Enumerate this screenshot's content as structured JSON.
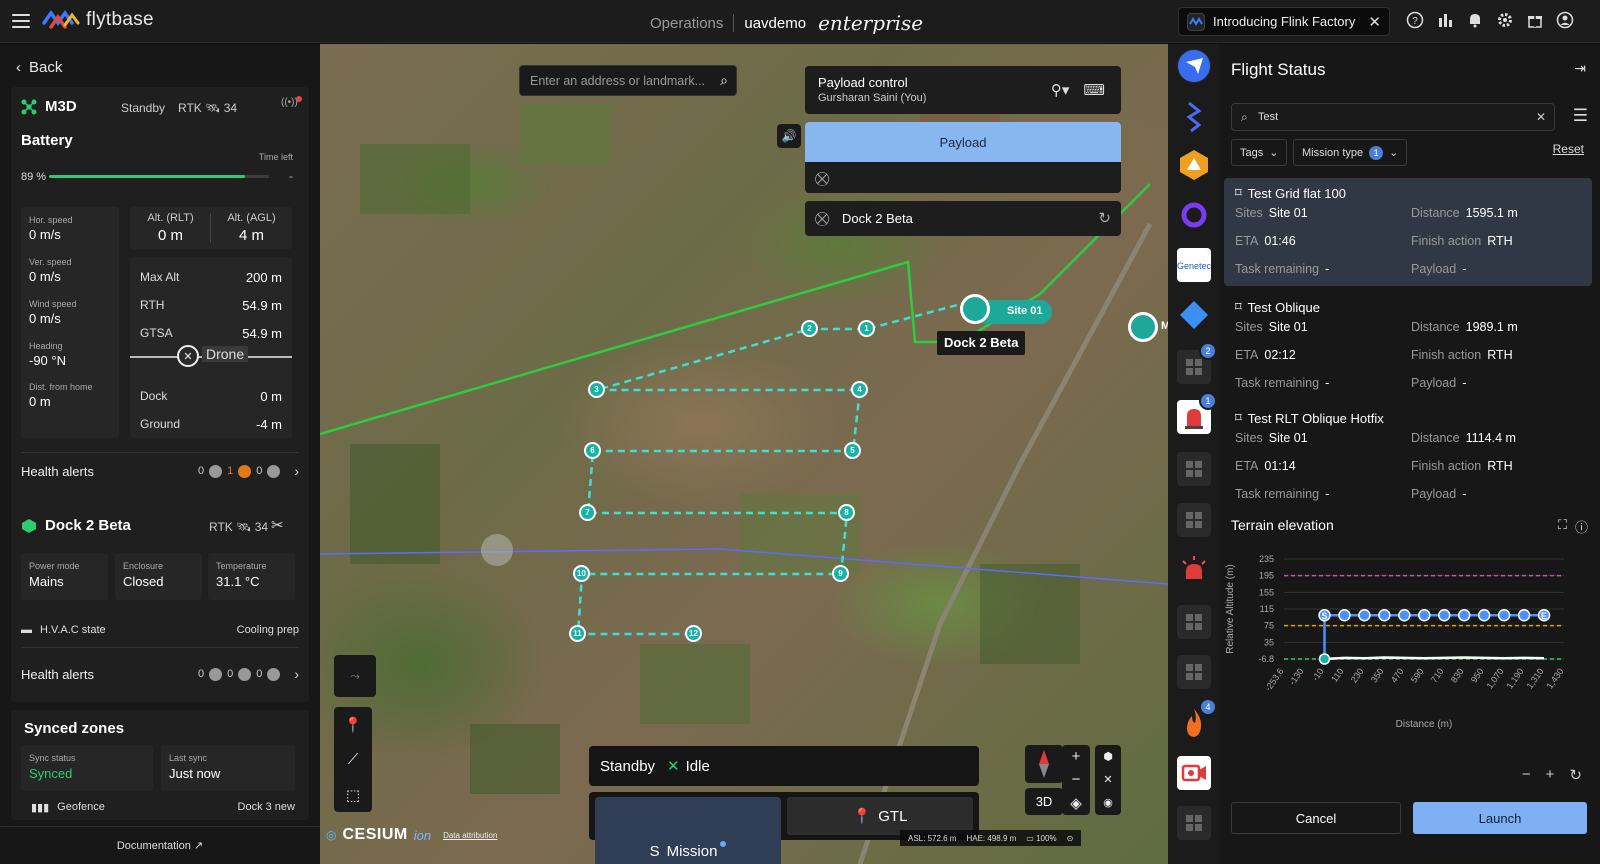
{
  "app": {
    "brand": "flytbase",
    "nav_section": "Operations",
    "org": "uavdemo",
    "edition": "enterprise",
    "announcement": "Introducing Flink Factory"
  },
  "colors": {
    "accent_blue": "#7fb0f3",
    "waypoint_teal": "#16b3a6",
    "route_green": "#2ecc40",
    "battery_green": "#2ecc71",
    "selected_row": "#303846"
  },
  "left": {
    "back_label": "Back",
    "drone": {
      "name": "M3D",
      "state": "Standby",
      "rtk": "RTK",
      "rtk_count": "34",
      "battery_title": "Battery",
      "time_left_label": "Time left",
      "time_left_value": "-",
      "battery_pct_label": "89 %",
      "battery_level": 0.89,
      "hor_speed_label": "Hor. speed",
      "hor_speed": "0 m/s",
      "ver_speed_label": "Ver. speed",
      "ver_speed": "0 m/s",
      "wind_label": "Wind speed",
      "wind": "0 m/s",
      "heading_label": "Heading",
      "heading": "-90 °N",
      "dist_label": "Dist. from home",
      "dist": "0 m",
      "alt_rlt_label": "Alt. (RLT)",
      "alt_rlt": "0 m",
      "alt_agl_label": "Alt. (AGL)",
      "alt_agl": "4 m",
      "max_alt_label": "Max Alt",
      "max_alt": "200 m",
      "rth_label": "RTH",
      "rth": "54.9 m",
      "gtsa_label": "GTSA",
      "gtsa": "54.9 m",
      "drone_tag": "Drone",
      "dock_label": "Dock",
      "dock_val": "0 m",
      "ground_label": "Ground",
      "ground_val": "-4 m",
      "health_label": "Health alerts",
      "alert_counts": [
        "0",
        "1",
        "0"
      ]
    },
    "dock": {
      "name": "Dock 2 Beta",
      "rtk": "RTK",
      "rtk_count": "34",
      "power_label": "Power mode",
      "power": "Mains",
      "enclosure_label": "Enclosure",
      "enclosure": "Closed",
      "temp_label": "Temperature",
      "temp": "31.1 °C",
      "hvac_label": "H.V.A.C state",
      "hvac": "Cooling prep",
      "health_label": "Health alerts",
      "alert_counts": [
        "0",
        "0",
        "0"
      ]
    },
    "sync": {
      "title": "Synced zones",
      "status_label": "Sync status",
      "status": "Synced",
      "last_label": "Last sync",
      "last": "Just now",
      "geofence_label": "Geofence",
      "geofence_value": "Dock 3 new"
    },
    "docs_label": "Documentation"
  },
  "map": {
    "search_placeholder": "Enter an address or landmark...",
    "payload_control_title": "Payload control",
    "payload_control_user": "Gursharan Saini (You)",
    "payload_button": "Payload",
    "dock_feed_label": "Dock 2 Beta",
    "waypoints": [
      "1",
      "2",
      "3",
      "4",
      "5",
      "6",
      "7",
      "8",
      "9",
      "10",
      "11",
      "12"
    ],
    "site_label": "Site 01",
    "dock_label": "Dock 2 Beta",
    "pin_label": "M",
    "status_state": "Standby",
    "status_drone": "Idle",
    "mode_mission": "Mission",
    "mode_gtl": "GTL",
    "view_3d": "3D",
    "cesium": "CESIUM",
    "cesium_ion": "ion",
    "attribution": "Data attribution",
    "asl": "ASL: 572.6 m",
    "hae": "HAE: 498.9 m",
    "zoom_pct": "100%"
  },
  "rail": {
    "badges": [
      "2",
      "1",
      "4"
    ]
  },
  "right": {
    "title": "Flight Status",
    "search_value": "Test",
    "tags_label": "Tags",
    "mission_type_label": "Mission type",
    "mission_type_count": "1",
    "reset_label": "Reset",
    "missions": [
      {
        "name": "Test Grid flat 100",
        "sites": "Site 01",
        "distance": "1595.1 m",
        "eta": "01:46",
        "finish": "RTH",
        "task": "-",
        "payload": "-"
      },
      {
        "name": "Test Oblique",
        "sites": "Site 01",
        "distance": "1989.1 m",
        "eta": "02:12",
        "finish": "RTH",
        "task": "-",
        "payload": "-"
      },
      {
        "name": "Test RLT Oblique Hotfix",
        "sites": "Site 01",
        "distance": "1114.4 m",
        "eta": "01:14",
        "finish": "RTH",
        "task": "-",
        "payload": "-"
      }
    ],
    "labels": {
      "sites": "Sites",
      "distance": "Distance",
      "eta": "ETA",
      "finish": "Finish action",
      "task": "Task remaining",
      "payload": "Payload"
    },
    "terrain_title": "Terrain elevation",
    "cancel_label": "Cancel",
    "launch_label": "Launch"
  },
  "chart_data": {
    "type": "line",
    "title": "Terrain elevation",
    "xlabel": "Distance (m)",
    "ylabel": "Relative Altitude (m)",
    "y_ticks": [
      "235",
      "195",
      "155",
      "115",
      "75",
      "35",
      "-6.8"
    ],
    "x_ticks": [
      "-253.6",
      "-130",
      "-10",
      "110",
      "230",
      "350",
      "470",
      "590",
      "710",
      "830",
      "950",
      "1,070",
      "1,190",
      "1,310",
      "1,430"
    ],
    "ylim": [
      -6.8,
      235
    ],
    "xlim": [
      -253.6,
      1430
    ],
    "reference_lines": [
      {
        "y": 195,
        "color": "#c050c0",
        "style": "dashed"
      },
      {
        "y": 75,
        "color": "#e0a020",
        "style": "dashed"
      },
      {
        "y": -6.8,
        "color": "#2ecc71",
        "style": "dashed"
      }
    ],
    "series": [
      {
        "x": [
          -10,
          -10,
          110,
          230,
          350,
          470,
          590,
          710,
          830,
          950,
          1070,
          1190,
          1310
        ],
        "y": [
          -6.8,
          100,
          100,
          100,
          100,
          100,
          100,
          100,
          100,
          100,
          100,
          100,
          100
        ],
        "color": "#4a90ff"
      },
      {
        "x": [
          -10,
          110,
          230,
          350,
          470,
          590,
          710,
          830,
          950,
          1070,
          1190,
          1310
        ],
        "y": [
          -6.8,
          -4,
          -5,
          -3,
          -4,
          -5,
          -4,
          -3,
          -4,
          -5,
          -4,
          -5
        ],
        "color": "#ffffff"
      }
    ],
    "markers": [
      "S",
      "E"
    ],
    "grid": true
  }
}
